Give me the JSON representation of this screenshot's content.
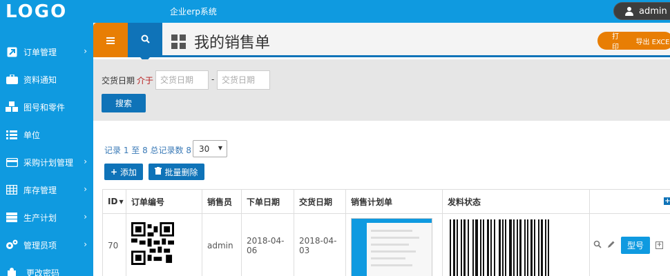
{
  "header": {
    "logo": "LOGO",
    "app_title": "企业erp系统",
    "user": "admin"
  },
  "sidebar": {
    "items": [
      {
        "label": "订单管理",
        "icon": "external-link-icon",
        "has_arrow": true
      },
      {
        "label": "资料通知",
        "icon": "briefcase-icon",
        "has_arrow": false
      },
      {
        "label": "图号和零件",
        "icon": "cubes-icon",
        "has_arrow": false
      },
      {
        "label": "单位",
        "icon": "list-icon",
        "has_arrow": false
      },
      {
        "label": "采购计划管理",
        "icon": "credit-card-icon",
        "has_arrow": true
      },
      {
        "label": "库存管理",
        "icon": "table-icon",
        "has_arrow": true
      },
      {
        "label": "生产计划",
        "icon": "server-icon",
        "has_arrow": true
      },
      {
        "label": "管理员项",
        "icon": "cogs-icon",
        "has_arrow": true
      },
      {
        "label": "更改密码",
        "icon": "puzzle-icon",
        "has_arrow": false
      }
    ]
  },
  "page": {
    "title": "我的销售单",
    "print_label": "打印",
    "export_label": "导出 EXCEL"
  },
  "filter": {
    "label": "交货日期",
    "between": "介于",
    "start_placeholder": "交货日期",
    "end_placeholder": "交货日期",
    "dash": "-",
    "search_label": "搜索"
  },
  "list": {
    "records_text": "记录 1 至 8 总记录数 8",
    "per_page": "30",
    "add_label": "添加",
    "bulk_delete_label": "批量删除"
  },
  "table": {
    "headers": [
      "ID",
      "订单编号",
      "销售员",
      "下单日期",
      "交货日期",
      "销售计划单",
      "发料状态"
    ],
    "rows": [
      {
        "id": "70",
        "salesperson": "admin",
        "order_date": "2018-04-06",
        "delivery_date": "2018-04-03",
        "model_label": "型号"
      }
    ]
  },
  "colors": {
    "brand": "#0f9ae0",
    "primary": "#0f73b8",
    "orange": "#e87e04"
  }
}
